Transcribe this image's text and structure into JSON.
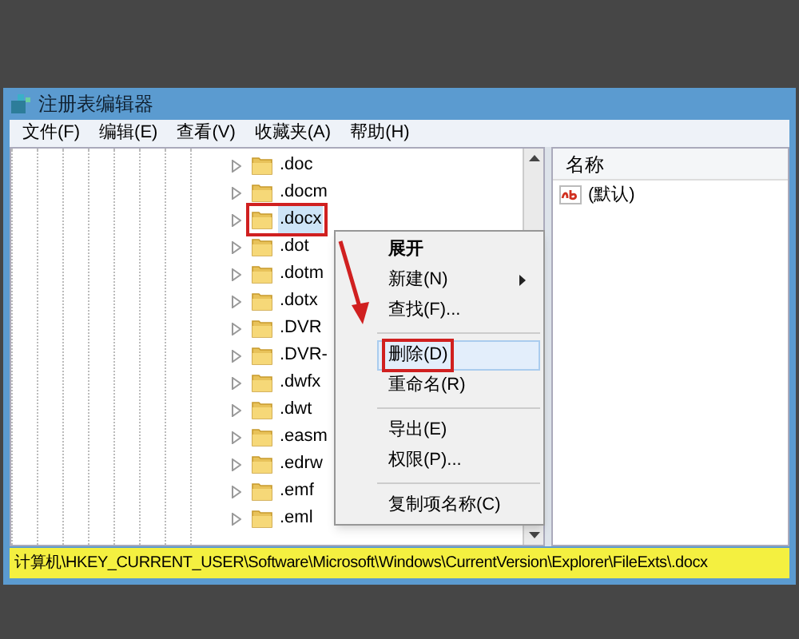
{
  "window": {
    "title": "注册表编辑器"
  },
  "menu_bar": [
    "文件(F)",
    "编辑(E)",
    "查看(V)",
    "收藏夹(A)",
    "帮助(H)"
  ],
  "tree": [
    {
      "label": ".doc",
      "selected": false,
      "annotated": false
    },
    {
      "label": ".docm",
      "selected": false,
      "annotated": false
    },
    {
      "label": ".docx",
      "selected": true,
      "annotated": true
    },
    {
      "label": ".dot",
      "selected": false,
      "annotated": false
    },
    {
      "label": ".dotm",
      "selected": false,
      "annotated": false
    },
    {
      "label": ".dotx",
      "selected": false,
      "annotated": false
    },
    {
      "label": ".DVR",
      "selected": false,
      "annotated": false
    },
    {
      "label": ".DVR-",
      "selected": false,
      "annotated": false
    },
    {
      "label": ".dwfx",
      "selected": false,
      "annotated": false
    },
    {
      "label": ".dwt",
      "selected": false,
      "annotated": false
    },
    {
      "label": ".easm",
      "selected": false,
      "annotated": false
    },
    {
      "label": ".edrw",
      "selected": false,
      "annotated": false
    },
    {
      "label": ".emf",
      "selected": false,
      "annotated": false
    },
    {
      "label": ".eml",
      "selected": false,
      "annotated": false
    }
  ],
  "context_menu": [
    {
      "kind": "item",
      "label": "展开",
      "bold": true,
      "submenu": false,
      "selected": false,
      "annotated": false
    },
    {
      "kind": "item",
      "label": "新建(N)",
      "bold": false,
      "submenu": true,
      "selected": false,
      "annotated": false
    },
    {
      "kind": "item",
      "label": "查找(F)...",
      "bold": false,
      "submenu": false,
      "selected": false,
      "annotated": false
    },
    {
      "kind": "separator"
    },
    {
      "kind": "item",
      "label": "删除(D)",
      "bold": false,
      "submenu": false,
      "selected": true,
      "annotated": true
    },
    {
      "kind": "item",
      "label": "重命名(R)",
      "bold": false,
      "submenu": false,
      "selected": false,
      "annotated": false
    },
    {
      "kind": "separator"
    },
    {
      "kind": "item",
      "label": "导出(E)",
      "bold": false,
      "submenu": false,
      "selected": false,
      "annotated": false
    },
    {
      "kind": "item",
      "label": "权限(P)...",
      "bold": false,
      "submenu": false,
      "selected": false,
      "annotated": false
    },
    {
      "kind": "separator"
    },
    {
      "kind": "item",
      "label": "复制项名称(C)",
      "bold": false,
      "submenu": false,
      "selected": false,
      "annotated": false
    }
  ],
  "values": {
    "column": "名称",
    "rows": [
      {
        "name": "(默认)"
      }
    ]
  },
  "status_bar": {
    "text": "计算机\\HKEY_CURRENT_USER\\Software\\Microsoft\\Windows\\CurrentVersion\\Explorer\\FileExts\\.docx",
    "highlighted": true
  }
}
